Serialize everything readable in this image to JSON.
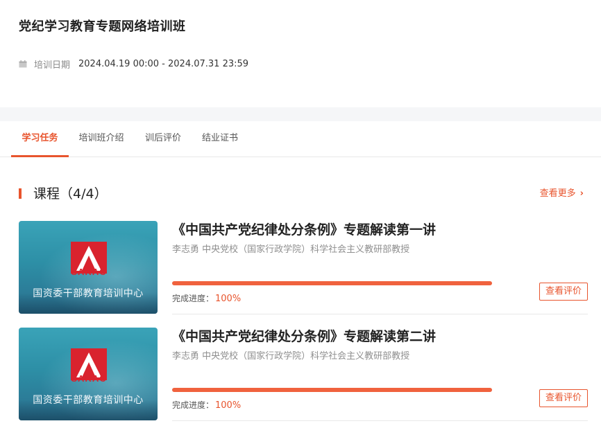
{
  "header": {
    "title": "党纪学习教育专题网络培训班",
    "date_label": "培训日期",
    "date_range": "2024.04.19 00:00 - 2024.07.31 23:59"
  },
  "tabs": [
    {
      "label": "学习任务",
      "active": true
    },
    {
      "label": "培训班介绍",
      "active": false
    },
    {
      "label": "训后评价",
      "active": false
    },
    {
      "label": "结业证书",
      "active": false
    }
  ],
  "section": {
    "title": "课程（4/4）",
    "more_label": "查看更多",
    "accent_color": "#e8542d"
  },
  "courses": [
    {
      "title": "《中国共产党纪律处分条例》专题解读第一讲",
      "lecturer": "李志勇 中央党校（国家行政学院）科学社会主义教研部教授",
      "thumb_logo_text": "SARAC",
      "thumb_caption": "国资委干部教育培训中心",
      "progress_label": "完成进度：",
      "progress_text": "100%",
      "progress": 1.0,
      "eval_label": "查看评价"
    },
    {
      "title": "《中国共产党纪律处分条例》专题解读第二讲",
      "lecturer": "李志勇 中央党校（国家行政学院）科学社会主义教研部教授",
      "thumb_logo_text": "SARAC",
      "thumb_caption": "国资委干部教育培训中心",
      "progress_label": "完成进度：",
      "progress_text": "100%",
      "progress": 1.0,
      "eval_label": "查看评价"
    }
  ]
}
